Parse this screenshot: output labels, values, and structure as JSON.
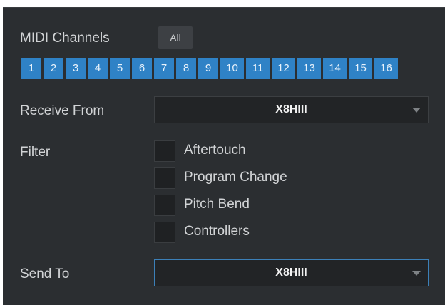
{
  "midi": {
    "channels_label": "MIDI Channels",
    "all_label": "All",
    "channels": [
      "1",
      "2",
      "3",
      "4",
      "5",
      "6",
      "7",
      "8",
      "9",
      "10",
      "11",
      "12",
      "13",
      "14",
      "15",
      "16"
    ]
  },
  "receive": {
    "label": "Receive From",
    "value": "X8HIII"
  },
  "filter": {
    "label": "Filter",
    "options": [
      {
        "label": "Aftertouch",
        "checked": false
      },
      {
        "label": "Program Change",
        "checked": false
      },
      {
        "label": "Pitch Bend",
        "checked": false
      },
      {
        "label": "Controllers",
        "checked": false
      }
    ]
  },
  "send": {
    "label": "Send To",
    "value": "X8HIII"
  },
  "colors": {
    "panel_bg": "#2b2e31",
    "channel_active": "#2f82c6",
    "dropdown_focus_border": "#3c80b8"
  }
}
